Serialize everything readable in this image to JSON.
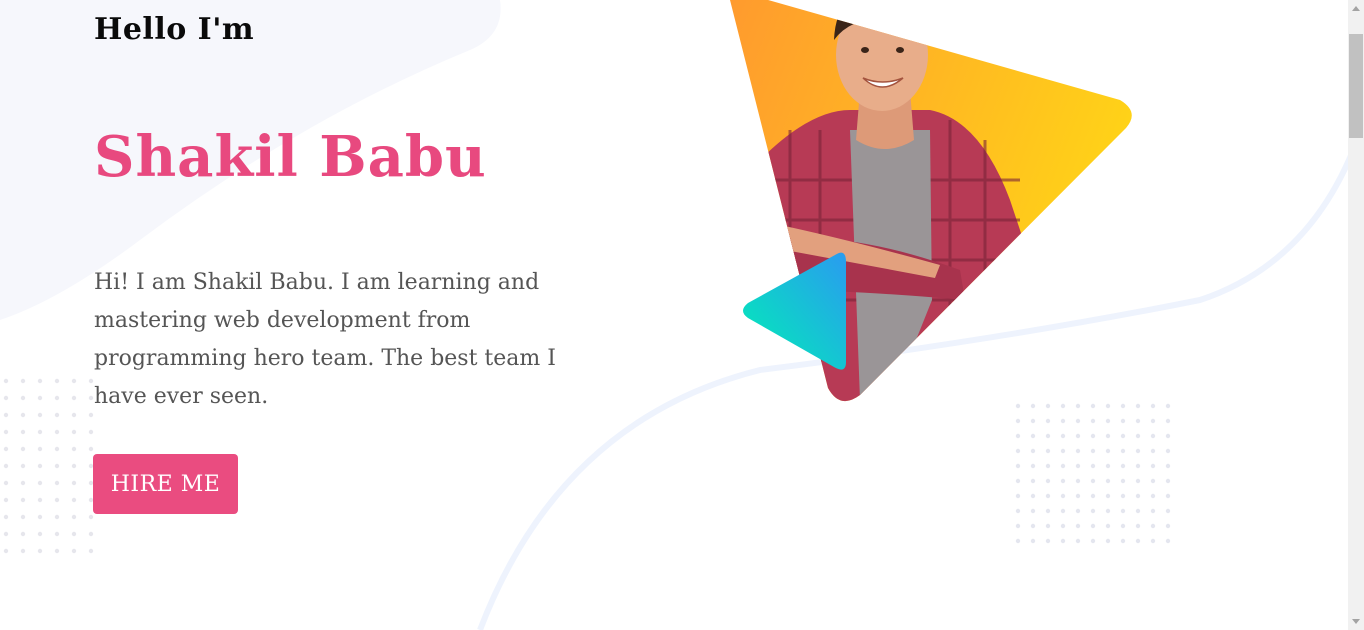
{
  "hero": {
    "greeting": "Hello I'm",
    "name": "Shakil Babu",
    "intro": "Hi! I am Shakil Babu. I am learning and mastering web development from programming hero team. The best team I have ever seen.",
    "cta_label": "HIRE ME"
  },
  "colors": {
    "accent": "#ea4c80",
    "name_color": "#e8497f",
    "triangle_start": "#ff9a2e",
    "triangle_end": "#ffd417",
    "play_start": "#00f0b5",
    "play_end": "#2a9bf0"
  },
  "icons": {
    "play": "play-triangle-icon"
  }
}
